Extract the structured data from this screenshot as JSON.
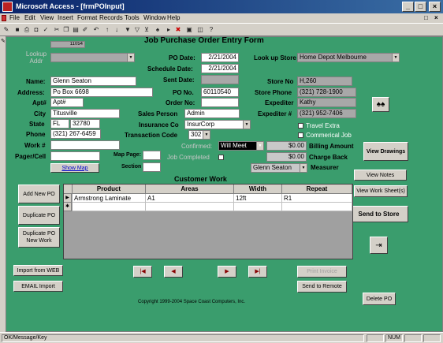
{
  "window": {
    "title": "Microsoft Access - [frmPOInput]"
  },
  "menu": [
    "File",
    "Edit",
    "View",
    "Insert",
    "Format",
    "Records",
    "Tools",
    "Window",
    "Help"
  ],
  "form": {
    "record_id": "11054",
    "heading": "Job Purchase Order Entry Form",
    "lookup_addr_label": "Lookup Addr",
    "po_date_label": "PO Date:",
    "po_date": "2/21/2004",
    "schedule_date_label": "Schedule Date:",
    "schedule_date": "2/21/2004",
    "sent_date_label": "Sent Date:",
    "lookup_store_label": "Look up Store",
    "lookup_store": "Home Depot Melbourne",
    "name_label": "Name:",
    "name": "Glenn Seaton",
    "address_label": "Address:",
    "address": "Po Box 6698",
    "apt_label": "Apt#",
    "apt": "Apt#",
    "city_label": "City",
    "city": "Titusville",
    "state_label": "State",
    "state": "FL",
    "zip": "32780",
    "phone_label": "Phone",
    "phone": "(321) 267-6459",
    "work_label": "Work #",
    "pager_label": "Pager/Cell",
    "show_map": "Show Map",
    "map_page_label": "Map Page:",
    "section_label": "Section",
    "po_no_label": "PO No.",
    "po_no": "60110540",
    "order_no_label": "Order No:",
    "sales_person_label": "Sales Person",
    "sales_person": "Admin",
    "insurance_label": "Insurance Co",
    "insurance": "InsurCorp",
    "transaction_label": "Transaction Code",
    "transaction": "302",
    "store_no_label": "Store No",
    "store_no": "H,260",
    "store_phone_label": "Store Phone",
    "store_phone": "(321) 728-1900",
    "expediter_label": "Expediter",
    "expediter": "Kathy",
    "expediter_no_label": "Expediter #",
    "expediter_no": "(321) 952-7406",
    "travel_extra": "Travel Extra",
    "commercial_job": "Commerical Job",
    "confirmed_label": "Confirmed:",
    "confirmed": "Will Meet",
    "job_completed_label": "Job Completed",
    "billing_amount": "$0.00",
    "billing_amount_label": "Billing Amount",
    "charge_back": "$0.00",
    "charge_back_label": "Charge Back",
    "measurer": "Glenn Seaton",
    "measurer_label": "Measurer",
    "view_drawings": "View Drawings",
    "view_notes": "View Notes",
    "view_work_sheets": "View Work Sheet(s)",
    "send_to_store": "Send to Store",
    "customer_work_label": "Customer Work",
    "add_new_po": "Add New PO",
    "duplicate_po": "Duplicate PO",
    "duplicate_po_new_work": "Duplicate PO New Work",
    "import_web": "Import from WEB",
    "email_import": "EMAIL Import",
    "print_invoice": "Print Invoice",
    "send_to_remote": "Send to Remote",
    "delete_po": "Delete PO",
    "copyright": "Copyright 1999-2004 Space Coast Computers, Inc."
  },
  "grid": {
    "headers": [
      "Product",
      "Areas",
      "Width",
      "Repeat"
    ],
    "rows": [
      {
        "product": "Armstrong Laminate",
        "areas": "A1",
        "width": "12ft",
        "repeat": "R1"
      }
    ]
  },
  "status": {
    "left": "OK/Message/Key",
    "num": "NUM"
  }
}
